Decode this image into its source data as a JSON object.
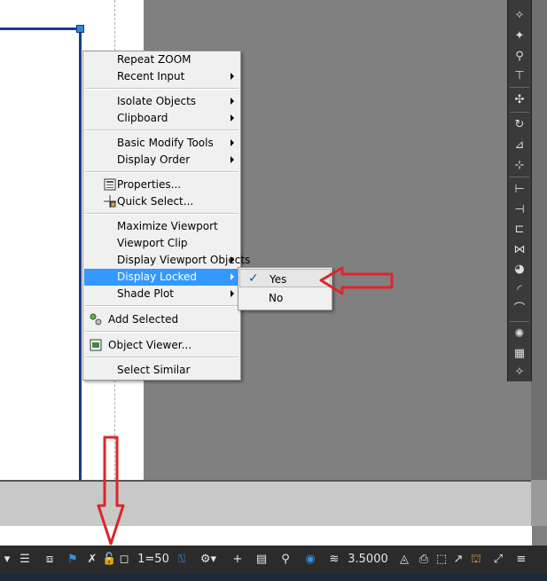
{
  "context_menu": {
    "items": [
      {
        "label": "Repeat ZOOM"
      },
      {
        "label": "Recent Input"
      },
      {
        "label": "Isolate Objects"
      },
      {
        "label": "Clipboard"
      },
      {
        "label": "Basic Modify Tools"
      },
      {
        "label": "Display Order"
      },
      {
        "label": "Properties..."
      },
      {
        "label": "Quick Select..."
      },
      {
        "label": "Maximize Viewport"
      },
      {
        "label": "Viewport Clip"
      },
      {
        "label": "Display Viewport Objects"
      },
      {
        "label": "Display Locked"
      },
      {
        "label": "Shade Plot"
      },
      {
        "label": "Add Selected"
      },
      {
        "label": "Object Viewer..."
      },
      {
        "label": "Select Similar"
      }
    ]
  },
  "submenu": {
    "items": [
      {
        "label": "Yes",
        "checked": true
      },
      {
        "label": "No",
        "checked": false
      }
    ]
  },
  "status_bar": {
    "scale": "1=50",
    "value": "3.5000"
  },
  "colors": {
    "highlight": "#3399ff",
    "annotation_arrow": "#e0242b",
    "viewport_frame": "#1a3a8a"
  }
}
